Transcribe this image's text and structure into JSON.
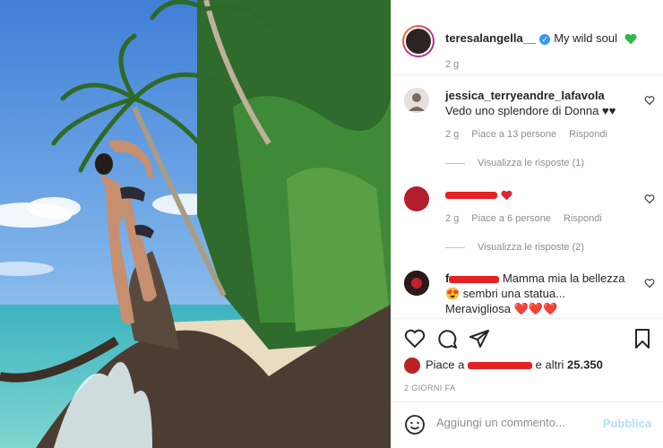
{
  "post": {
    "username": "teresalangella__",
    "caption": "My wild soul",
    "time": "2 g"
  },
  "comments": [
    {
      "username": "jessica_terryeandre_lafavola",
      "text": "Vedo uno splendore di Donna ♥♥",
      "time": "2 g",
      "likes": "Piace a 13 persone",
      "reply": "Rispondi",
      "view_replies": "Visualizza le risposte (1)"
    },
    {
      "username": "",
      "text": "",
      "time": "2 g",
      "likes": "Piace a 6 persone",
      "reply": "Rispondi",
      "view_replies": "Visualizza le risposte (2)"
    },
    {
      "username": "f",
      "text": "Mamma mia la bellezza 😍 sembri una statua... Meravigliosa ❤️❤️❤️"
    }
  ],
  "likes": {
    "prefix": "Piace a",
    "suffix": "e altri",
    "count": "25.350"
  },
  "date": "2 GIORNI FA",
  "add_comment": {
    "placeholder": "Aggiungi un commento...",
    "publish": "Pubblica"
  },
  "colors": {
    "verified": "#3897f0",
    "publish_disabled": "#b2dffc",
    "redaction": "#e52222"
  }
}
